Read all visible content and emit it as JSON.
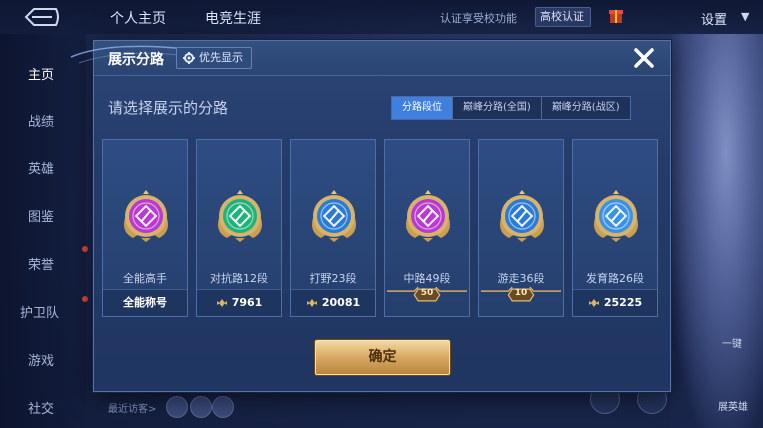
{
  "topbar": {
    "tabs": [
      "个人主页",
      "电竞生涯"
    ],
    "notice": "认证享受校功能",
    "campus_badge": "高校认证",
    "settings": "设置"
  },
  "sidebar": {
    "items": [
      {
        "label": "主页",
        "active": true
      },
      {
        "label": "战绩",
        "active": false
      },
      {
        "label": "英雄",
        "active": false
      },
      {
        "label": "图鉴",
        "active": false
      },
      {
        "label": "荣誉",
        "active": false
      },
      {
        "label": "护卫队",
        "active": false
      },
      {
        "label": "游戏",
        "active": false
      },
      {
        "label": "社交",
        "active": false
      }
    ]
  },
  "background": {
    "recent_visitors": "最近访客>",
    "right_btn_1": "一键",
    "right_btn_2": "展英雄"
  },
  "modal": {
    "title": "展示分路",
    "priority_button": "优先显示",
    "subtitle": "请选择展示的分路",
    "segments": [
      {
        "label": "分路段位",
        "active": true
      },
      {
        "label": "巅峰分路(全国)",
        "active": false
      },
      {
        "label": "巅峰分路(战区)",
        "active": false
      }
    ],
    "cards": [
      {
        "role": "全能高手",
        "foot": "全能称号",
        "value_icon": false,
        "tier_badge": "",
        "emblem": "allround-emblem-icon",
        "color": "#b83ad1"
      },
      {
        "role": "对抗路12段",
        "foot": "7961",
        "value_icon": true,
        "tier_badge": "",
        "emblem": "clash-lane-emblem-icon",
        "color": "#1fb37a"
      },
      {
        "role": "打野23段",
        "foot": "20081",
        "value_icon": true,
        "tier_badge": "",
        "emblem": "jungle-emblem-icon",
        "color": "#2a7bd6"
      },
      {
        "role": "中路49段",
        "foot": "",
        "value_icon": false,
        "tier_badge": "50",
        "emblem": "mid-lane-emblem-icon",
        "color": "#b83ad1"
      },
      {
        "role": "游走36段",
        "foot": "",
        "value_icon": false,
        "tier_badge": "10",
        "emblem": "roam-emblem-icon",
        "color": "#2a7bd6"
      },
      {
        "role": "发育路26段",
        "foot": "25225",
        "value_icon": true,
        "tier_badge": "",
        "emblem": "farm-lane-emblem-icon",
        "color": "#3a92e6"
      }
    ],
    "confirm": "确定"
  },
  "colors": {
    "accent_blue": "#3f7fde",
    "gold": "#d7a962"
  }
}
